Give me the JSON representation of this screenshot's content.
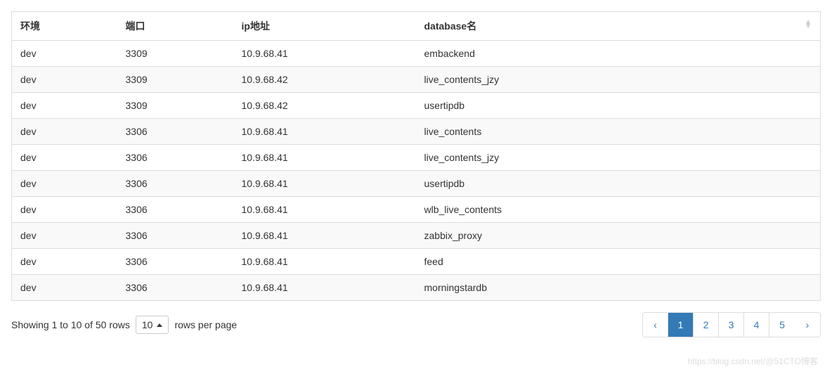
{
  "table": {
    "headers": {
      "env": "环境",
      "port": "端口",
      "ip": "ip地址",
      "database": "database名"
    },
    "rows": [
      {
        "env": "dev",
        "port": "3309",
        "ip": "10.9.68.41",
        "db": "embackend"
      },
      {
        "env": "dev",
        "port": "3309",
        "ip": "10.9.68.42",
        "db": "live_contents_jzy"
      },
      {
        "env": "dev",
        "port": "3309",
        "ip": "10.9.68.42",
        "db": "usertipdb"
      },
      {
        "env": "dev",
        "port": "3306",
        "ip": "10.9.68.41",
        "db": "live_contents"
      },
      {
        "env": "dev",
        "port": "3306",
        "ip": "10.9.68.41",
        "db": "live_contents_jzy"
      },
      {
        "env": "dev",
        "port": "3306",
        "ip": "10.9.68.41",
        "db": "usertipdb"
      },
      {
        "env": "dev",
        "port": "3306",
        "ip": "10.9.68.41",
        "db": "wlb_live_contents"
      },
      {
        "env": "dev",
        "port": "3306",
        "ip": "10.9.68.41",
        "db": "zabbix_proxy"
      },
      {
        "env": "dev",
        "port": "3306",
        "ip": "10.9.68.41",
        "db": "feed"
      },
      {
        "env": "dev",
        "port": "3306",
        "ip": "10.9.68.41",
        "db": "morningstardb"
      }
    ]
  },
  "footer": {
    "info_prefix": "Showing 1 to 10 of 50 rows",
    "page_size": "10",
    "info_suffix": "rows per page"
  },
  "pagination": {
    "prev": "‹",
    "pages": [
      "1",
      "2",
      "3",
      "4",
      "5"
    ],
    "active": "1",
    "next": "›"
  },
  "watermark": "https://blog.csdn.net/@51CTO博客"
}
